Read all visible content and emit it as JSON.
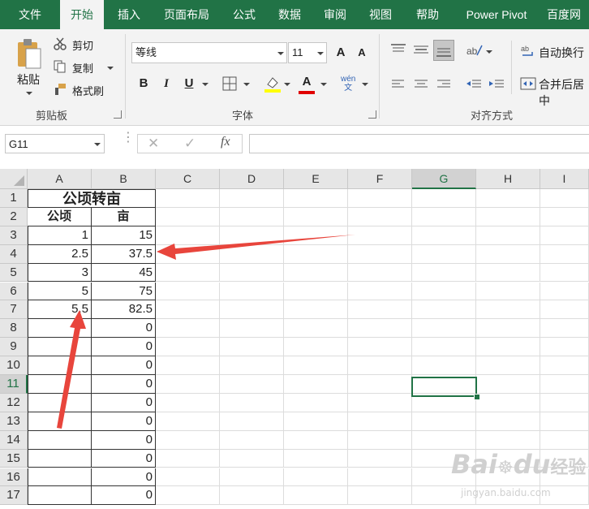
{
  "tabs": [
    "文件",
    "开始",
    "插入",
    "页面布局",
    "公式",
    "数据",
    "审阅",
    "视图",
    "帮助",
    "Power Pivot",
    "百度网"
  ],
  "clipboard": {
    "paste": "粘贴",
    "cut": "剪切",
    "copy": "复制",
    "format_painter": "格式刷",
    "group": "剪贴板"
  },
  "font": {
    "name": "等线",
    "size": "11",
    "group": "字体",
    "bold": "B",
    "italic": "I",
    "underline": "U",
    "grow": "A",
    "shrink": "A",
    "color_a": "A",
    "pinyin": "wén\n文"
  },
  "align": {
    "group": "对齐方式",
    "wrap": "自动换行",
    "merge": "合并后居中"
  },
  "namebox": "G11",
  "formula": {
    "cancel": "✕",
    "enter": "✓",
    "fx": "fx",
    "value": ""
  },
  "columns": [
    "A",
    "B",
    "C",
    "D",
    "E",
    "F",
    "G",
    "H",
    "I"
  ],
  "selected_col": "G",
  "selected_row": "11",
  "rows": [
    "1",
    "2",
    "3",
    "4",
    "5",
    "6",
    "7",
    "8",
    "9",
    "10",
    "11",
    "12",
    "13",
    "14",
    "15",
    "16",
    "17"
  ],
  "sheet": {
    "title": "公顷转亩",
    "headers": [
      "公顷",
      "亩"
    ],
    "a": [
      "1",
      "2.5",
      "3",
      "5",
      "5.5",
      "",
      "",
      "",
      "",
      "",
      "",
      "",
      "",
      "",
      "",
      ""
    ],
    "b": [
      "15",
      "37.5",
      "45",
      "75",
      "82.5",
      "0",
      "0",
      "0",
      "0",
      "0",
      "0",
      "0",
      "0",
      "0",
      "0"
    ]
  },
  "watermark": {
    "brand": "Bai",
    "brand2": "du",
    "jing": "经验",
    "url": "jingyan.baidu.com"
  },
  "colors": {
    "accent": "#217346",
    "arrow": "#e8453c"
  }
}
